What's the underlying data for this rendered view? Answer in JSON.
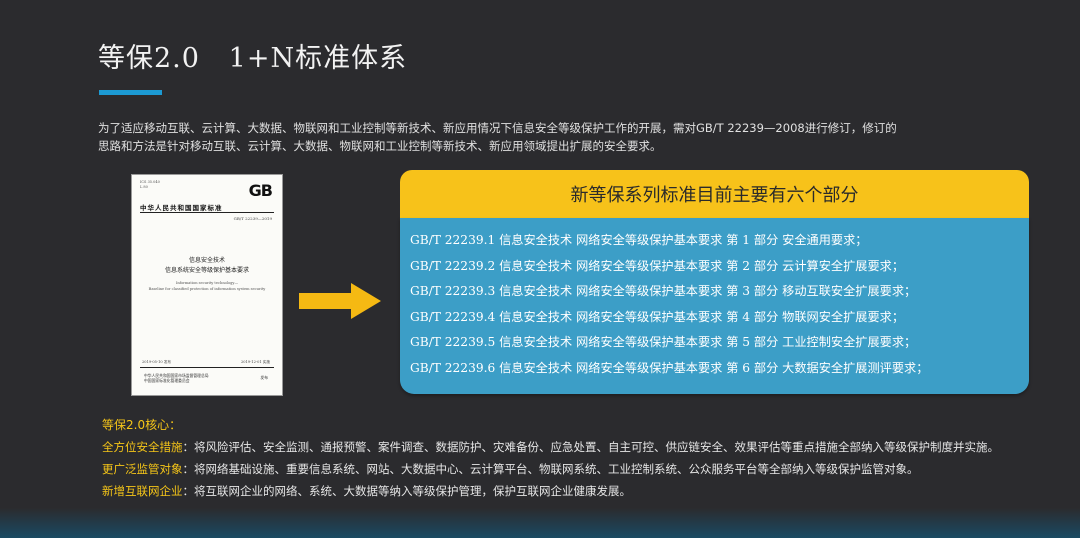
{
  "title": "等保2.0   1+N标准体系",
  "intro": "为了适应移动互联、云计算、大数据、物联网和工业控制等新技术、新应用情况下信息安全等级保护工作的开展，需对GB/T 22239—2008进行修订，修订的思路和方法是针对移动互联、云计算、大数据、物联网和工业控制等新技术、新应用领域提出扩展的安全要求。",
  "document": {
    "top_text_1": "ICS 35.040",
    "top_text_2": "L 80",
    "logo": "GB",
    "org": "中华人民共和国国家标准",
    "std_no": "GB/T 22239—2019",
    "title_cn_1": "信息安全技术",
    "title_cn_2": "信息系统安全等级保护基本要求",
    "title_en_1": "Information security technology—",
    "title_en_2": "Baseline for classified protection of information system security",
    "issue_date": "2019-05-10 发布",
    "impl_date": "2019-12-01 实施",
    "publisher_1": "中华人民共和国国家市场监督管理总局",
    "publisher_2": "中国国家标准化管理委员会",
    "publisher_3": "发布"
  },
  "panel": {
    "header": "新等保系列标准目前主要有六个部分",
    "items": [
      "GB/T 22239.1 信息安全技术 网络安全等级保护基本要求 第 1 部分 安全通用要求；",
      "GB/T 22239.2 信息安全技术 网络安全等级保护基本要求 第 2 部分 云计算安全扩展要求；",
      "GB/T 22239.3 信息安全技术 网络安全等级保护基本要求 第 3 部分 移动互联安全扩展要求；",
      "GB/T 22239.4 信息安全技术 网络安全等级保护基本要求 第 4 部分 物联网安全扩展要求；",
      "GB/T 22239.5 信息安全技术 网络安全等级保护基本要求 第 5 部分 工业控制安全扩展要求；",
      "GB/T 22239.6 信息安全技术 网络安全等级保护基本要求 第 6 部分 大数据安全扩展测评要求；"
    ]
  },
  "core": {
    "title": "等保2.0核心：",
    "lines": [
      {
        "label": "全方位安全措施",
        "text": "：将风险评估、安全监测、通报预警、案件调查、数据防护、灾难备份、应急处置、自主可控、供应链安全、效果评估等重点措施全部纳入等级保护制度并实施。"
      },
      {
        "label": "更广泛监管对象",
        "text": "：将网络基础设施、重要信息系统、网站、大数据中心、云计算平台、物联网系统、工业控制系统、公众服务平台等全部纳入等级保护监管对象。"
      },
      {
        "label": "新增互联网企业",
        "text": "：将互联网企业的网络、系统、大数据等纳入等级保护管理，保护互联网企业健康发展。"
      }
    ]
  },
  "colors": {
    "background": "#2b2b2e",
    "accent_blue": "#1c9ad3",
    "panel_yellow": "#f7c21a",
    "panel_blue": "#3c9ec7",
    "highlight_yellow": "#f5c518"
  }
}
